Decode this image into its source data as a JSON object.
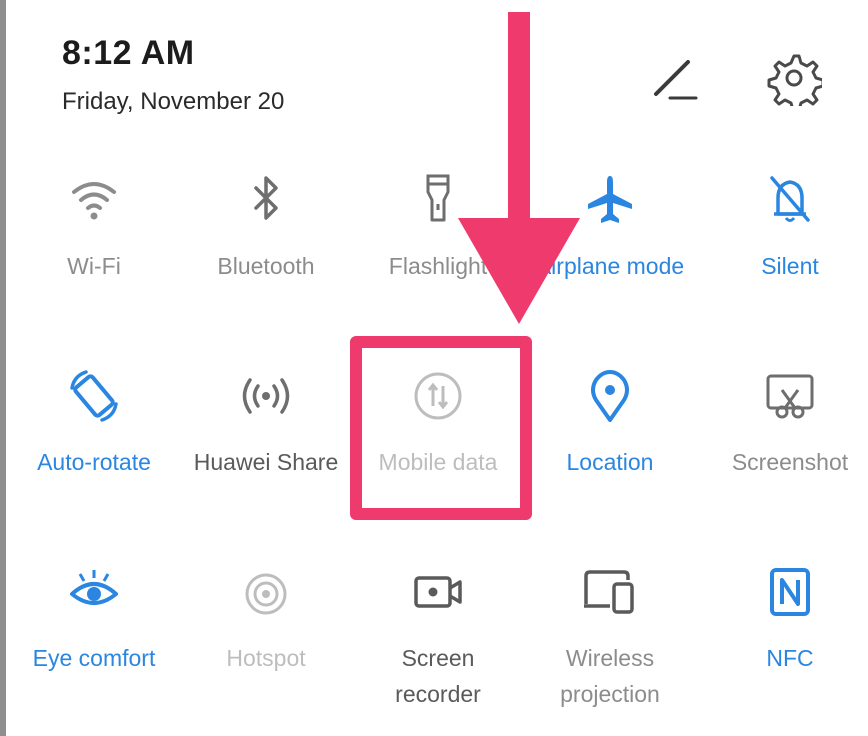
{
  "status": {
    "time": "8:12 AM",
    "date": "Friday, November 20"
  },
  "header_icons": [
    {
      "name": "edit-icon"
    },
    {
      "name": "gear-icon"
    }
  ],
  "tiles": [
    {
      "label": "Wi-Fi",
      "icon": "wifi-icon",
      "state": "off"
    },
    {
      "label": "Bluetooth",
      "icon": "bluetooth-icon",
      "state": "off"
    },
    {
      "label": "Flashlight",
      "icon": "flashlight-icon",
      "state": "off"
    },
    {
      "label": "Airplane mode",
      "icon": "airplane-icon",
      "state": "on"
    },
    {
      "label": "Silent",
      "icon": "bell-off-icon",
      "state": "on"
    },
    {
      "label": "Auto-rotate",
      "icon": "rotate-icon",
      "state": "on"
    },
    {
      "label": "Huawei Share",
      "icon": "share-wave-icon",
      "state": "off"
    },
    {
      "label": "Mobile data",
      "icon": "mobile-data-icon",
      "state": "disabled"
    },
    {
      "label": "Location",
      "icon": "location-pin-icon",
      "state": "on"
    },
    {
      "label": "Screenshot",
      "icon": "screenshot-icon",
      "state": "off"
    },
    {
      "label": "Eye comfort",
      "icon": "eye-icon",
      "state": "on"
    },
    {
      "label": "Hotspot",
      "icon": "hotspot-icon",
      "state": "disabled"
    },
    {
      "label_line1": "Screen",
      "label_line2": "recorder",
      "icon": "screen-recorder-icon",
      "state": "off"
    },
    {
      "label_line1": "Wireless",
      "label_line2": "projection",
      "icon": "wireless-projection-icon",
      "state": "off"
    },
    {
      "label": "NFC",
      "icon": "nfc-icon",
      "state": "on"
    }
  ],
  "colors": {
    "active": "#2a86e0",
    "inactive": "#8c8c8c",
    "disabled": "#bdbdbd",
    "highlight": "#ef3a6e"
  }
}
